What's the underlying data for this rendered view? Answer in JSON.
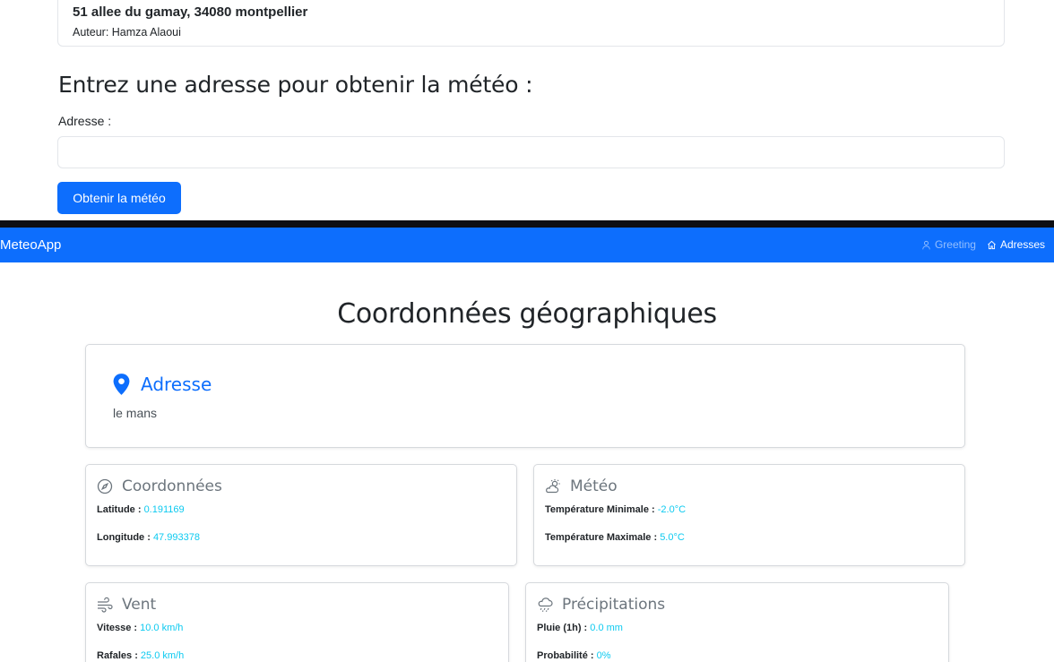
{
  "top_form": {
    "address_card": {
      "address": "51 allee du gamay, 34080 montpellier",
      "author": "Auteur: Hamza Alaoui"
    },
    "heading": "Entrez une adresse pour obtenir la météo :",
    "label": "Adresse :",
    "input_value": "",
    "submit_label": "Obtenir la météo"
  },
  "navbar": {
    "brand": "MeteoApp",
    "links": [
      {
        "label": "Greeting",
        "icon": "user-icon",
        "active": false
      },
      {
        "label": "Adresses",
        "icon": "home-icon",
        "active": true
      }
    ]
  },
  "main": {
    "title": "Coordonnées géographiques",
    "address_card": {
      "title": "Adresse",
      "value": "le mans",
      "icon": "map-pin-icon"
    },
    "coords_card": {
      "title": "Coordonnées",
      "icon": "compass-icon",
      "latitude_label": "Latitude :",
      "latitude": "0.191169",
      "longitude_label": "Longitude :",
      "longitude": "47.993378"
    },
    "meteo_card": {
      "title": "Météo",
      "icon": "cloud-sun-icon",
      "tmin_label": "Température Minimale :",
      "tmin": "-2.0°C",
      "tmax_label": "Température Maximale :",
      "tmax": "5.0°C"
    },
    "wind_card": {
      "title": "Vent",
      "icon": "wind-icon",
      "speed_label": "Vitesse :",
      "speed": "10.0 km/h",
      "gust_label": "Rafales :",
      "gust": "25.0 km/h"
    },
    "precip_card": {
      "title": "Précipitations",
      "icon": "cloud-rain-icon",
      "rain_label": "Pluie (1h) :",
      "rain": "0.0 mm",
      "prob_label": "Probabilité :",
      "prob": "0%"
    }
  },
  "colors": {
    "primary": "#0d6efd",
    "info": "#0dcaf0",
    "muted": "#6c757d"
  }
}
